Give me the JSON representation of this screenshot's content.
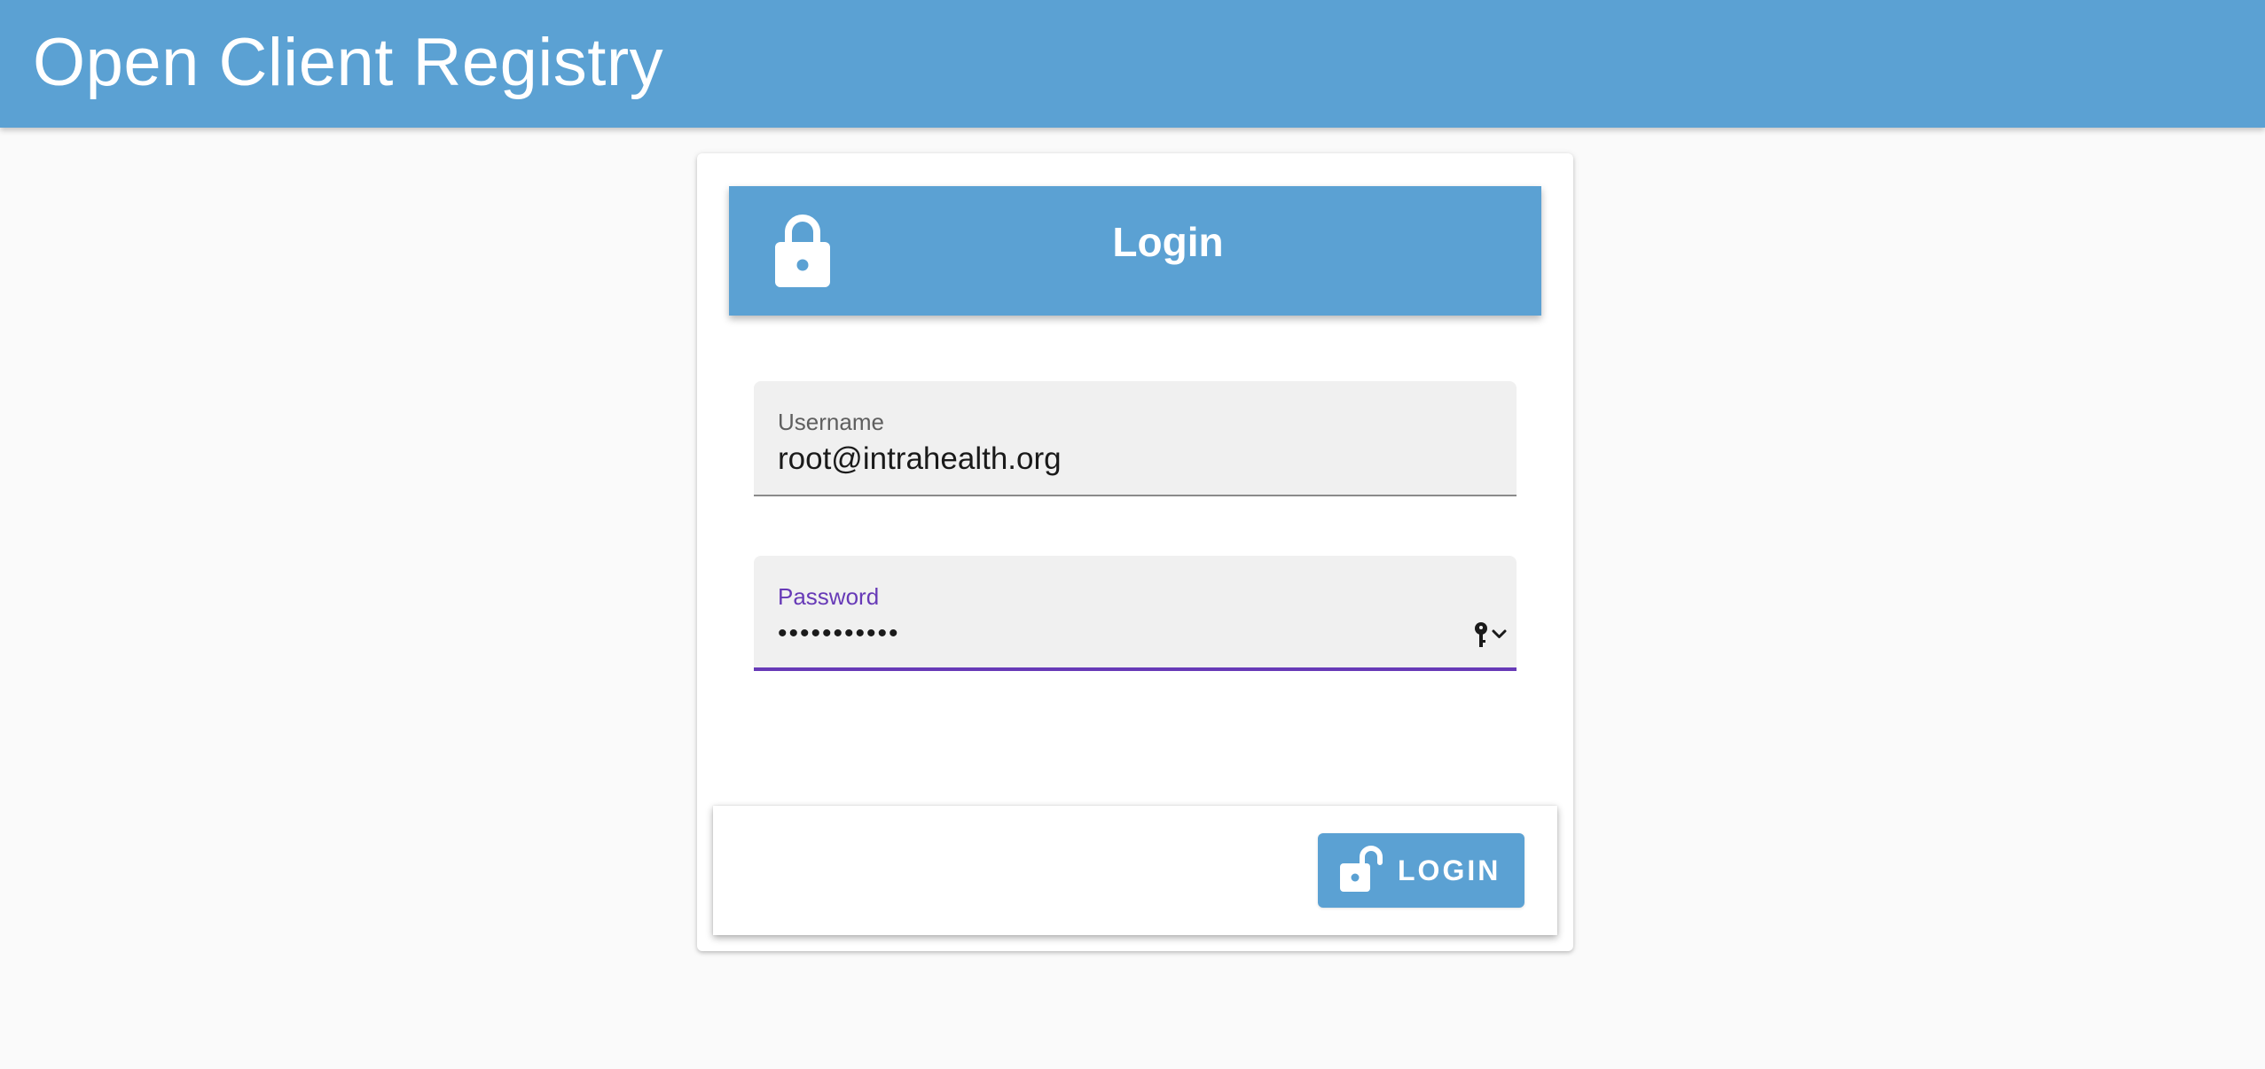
{
  "app": {
    "title": "Open Client Registry"
  },
  "login_card": {
    "header_title": "Login",
    "username": {
      "label": "Username",
      "value": "root@intrahealth.org"
    },
    "password": {
      "label": "Password",
      "value": "•••••••••••"
    },
    "login_button_label": "LOGIN"
  },
  "icons": {
    "header": "lock-icon",
    "password_field": "key-icon",
    "dropdown": "chevron-down-icon",
    "button": "lock-open-icon"
  },
  "colors": {
    "primary": "#5ba1d3",
    "focus_accent": "#673ab7",
    "background": "#fafafa",
    "card": "#ffffff",
    "field_fill": "#f0f0f0"
  }
}
